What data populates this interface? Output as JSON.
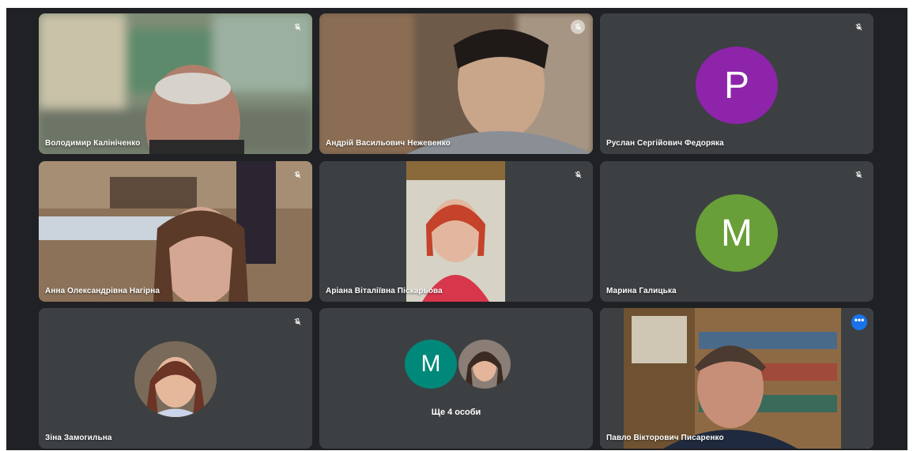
{
  "participants": [
    {
      "name": "Володимир Калініченко",
      "type": "video",
      "muted": true
    },
    {
      "name": "Андрій Васильович Нежевенко",
      "type": "video",
      "muted": true
    },
    {
      "name": "Руслан Сергійович Федоряка",
      "type": "avatar",
      "letter": "Р",
      "avatar_color": "#8e24aa",
      "muted": true
    },
    {
      "name": "Анна Олександрівна Нагірна",
      "type": "video",
      "muted": true
    },
    {
      "name": "Аріана Віталіївна Піскарьова",
      "type": "video",
      "muted": true
    },
    {
      "name": "Марина Галицька",
      "type": "avatar",
      "letter": "М",
      "avatar_color": "#689f38",
      "muted": true
    },
    {
      "name": "Зіна Замогильна",
      "type": "photo-avatar",
      "muted": true
    },
    {
      "name": "",
      "type": "others",
      "letter": "М",
      "avatar_color": "#00897b",
      "label": "Ще 4 особи"
    },
    {
      "name": "Павло Вікторович Писаренко",
      "type": "video",
      "active_speaker": true,
      "more_options_label": "•••"
    }
  ],
  "colors": {
    "background": "#202124",
    "tile": "#3c4043",
    "active_border": "#8ab4f8",
    "more_button": "#1a73e8"
  },
  "icons": {
    "mute": "mic-off-icon",
    "more": "more-options-icon"
  }
}
